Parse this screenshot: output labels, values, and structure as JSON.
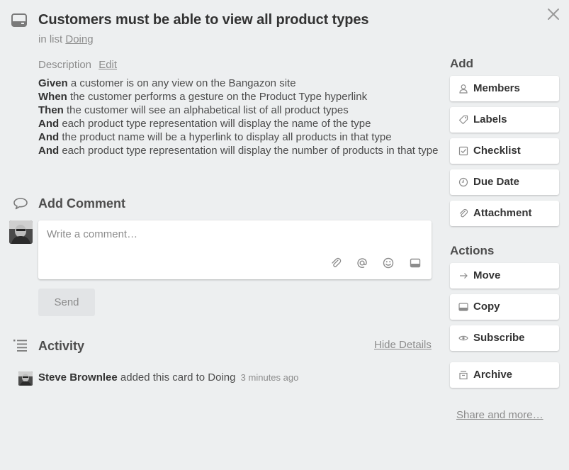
{
  "card": {
    "title": "Customers must be able to view all product types",
    "in_list_prefix": "in list",
    "list_name": "Doing"
  },
  "description": {
    "label": "Description",
    "edit_label": "Edit",
    "lines": [
      {
        "keyword": "Given",
        "text": " a customer is on any view on the Bangazon site"
      },
      {
        "keyword": "When",
        "text": " the customer performs a gesture on the Product Type hyperlink"
      },
      {
        "keyword": "Then",
        "text": " the customer will see an alphabetical list of all product types"
      },
      {
        "keyword": "And",
        "text": " each product type representation will display the name of the type"
      },
      {
        "keyword": "And",
        "text": " the product name will be a hyperlink to display all products in that type"
      },
      {
        "keyword": "And",
        "text": " each product type representation will display the number of products in that type"
      }
    ]
  },
  "comment": {
    "title": "Add Comment",
    "placeholder": "Write a comment…",
    "send_label": "Send",
    "icons": [
      "attachment-icon",
      "mention-icon",
      "emoji-icon",
      "card-icon"
    ]
  },
  "activity": {
    "title": "Activity",
    "hide_details_label": "Hide Details",
    "entries": [
      {
        "user": "Steve Brownlee",
        "action": " added this card to Doing",
        "time": "3 minutes ago"
      }
    ]
  },
  "sidebar": {
    "add_title": "Add",
    "add_buttons": [
      {
        "label": "Members",
        "icon": "person-icon"
      },
      {
        "label": "Labels",
        "icon": "tag-icon"
      },
      {
        "label": "Checklist",
        "icon": "checkbox-icon"
      },
      {
        "label": "Due Date",
        "icon": "clock-icon"
      },
      {
        "label": "Attachment",
        "icon": "paperclip-icon"
      }
    ],
    "actions_title": "Actions",
    "action_buttons": [
      {
        "label": "Move",
        "icon": "arrow-right-icon"
      },
      {
        "label": "Copy",
        "icon": "card-icon"
      },
      {
        "label": "Subscribe",
        "icon": "eye-icon"
      },
      {
        "label": "Archive",
        "icon": "archive-icon"
      }
    ],
    "share_label": "Share and more…"
  },
  "colors": {
    "background": "#edeff0",
    "text": "#4d4d4d",
    "muted": "#8c8c8c",
    "button_bg": "#ffffff"
  }
}
